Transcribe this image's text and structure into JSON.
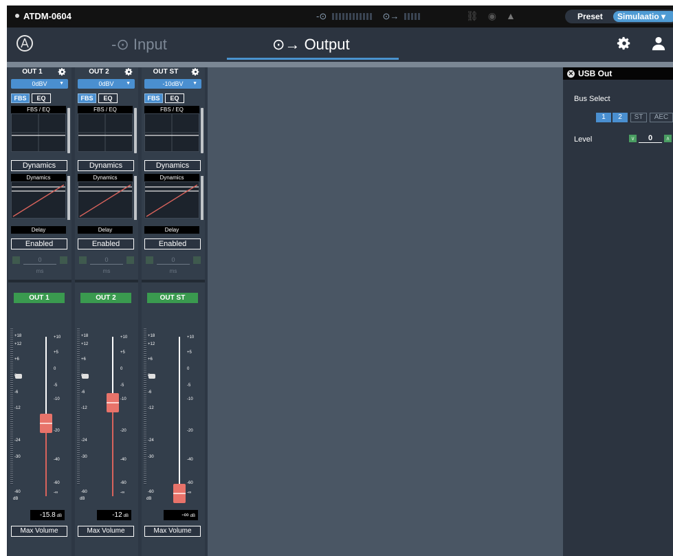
{
  "titlebar": {
    "device_name": "ATDM-0604",
    "preset_label": "Preset",
    "preset_value": "Simulaatio"
  },
  "nav": {
    "tabs": [
      {
        "label": "Input",
        "active": false
      },
      {
        "label": "Output",
        "active": true
      }
    ]
  },
  "channels": [
    {
      "name": "OUT 1",
      "level": "0dBV",
      "fbs_label": "FBS",
      "eq_label": "EQ",
      "fbs_eq_title": "FBS / EQ",
      "dynamics_button": "Dynamics",
      "dynamics_title": "Dynamics",
      "delay_title": "Delay",
      "delay_button": "Enabled",
      "delay_value": "0",
      "delay_unit": "ms",
      "badge": "OUT 1",
      "fader_value": "-15.8",
      "fader_unit": "dB",
      "max_button": "Max Volume"
    },
    {
      "name": "OUT 2",
      "level": "0dBV",
      "fbs_label": "FBS",
      "eq_label": "EQ",
      "fbs_eq_title": "FBS / EQ",
      "dynamics_button": "Dynamics",
      "dynamics_title": "Dynamics",
      "delay_title": "Delay",
      "delay_button": "Enabled",
      "delay_value": "0",
      "delay_unit": "ms",
      "badge": "OUT 2",
      "fader_value": "-12",
      "fader_unit": "dB",
      "max_button": "Max Volume"
    },
    {
      "name": "OUT ST",
      "level": "-10dBV",
      "fbs_label": "FBS",
      "eq_label": "EQ",
      "fbs_eq_title": "FBS / EQ",
      "dynamics_button": "Dynamics",
      "dynamics_title": "Dynamics",
      "delay_title": "Delay",
      "delay_button": "Enabled",
      "delay_value": "0",
      "delay_unit": "ms",
      "badge": "OUT ST",
      "fader_value": "-∞",
      "fader_unit": "dB",
      "max_button": "Max Volume"
    }
  ],
  "scale": {
    "left": [
      "+18",
      "+12",
      "+6",
      "0",
      "-6",
      "-12",
      "-24",
      "-30",
      "-60"
    ],
    "right": [
      "+10",
      "+5",
      "0",
      "-5",
      "-10",
      "-20",
      "-40",
      "-60",
      "-∞"
    ],
    "unit": "dB"
  },
  "usb_panel": {
    "title": "USB Out",
    "bus_select_label": "Bus Select",
    "bus_buttons": [
      {
        "label": "1",
        "active": true
      },
      {
        "label": "2",
        "active": true
      },
      {
        "label": "ST",
        "active": false
      },
      {
        "label": "AEC",
        "active": false
      }
    ],
    "level_label": "Level",
    "level_value": "0"
  },
  "colors": {
    "accent_blue": "#4a8fd0",
    "badge_green": "#3a9a4f",
    "fader_red": "#e8736a"
  }
}
